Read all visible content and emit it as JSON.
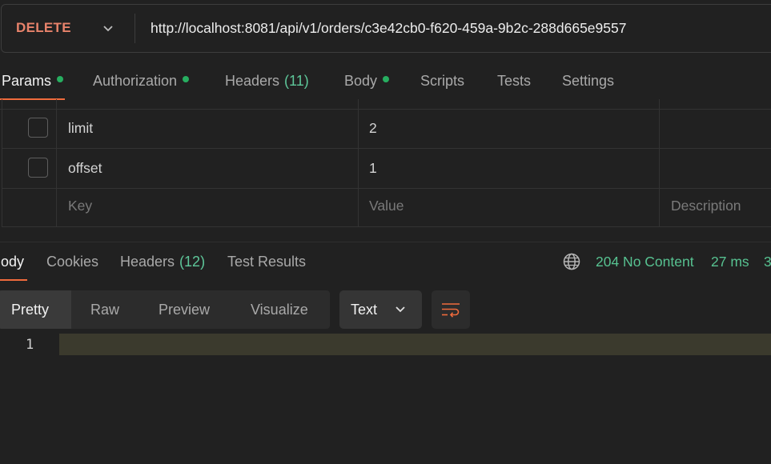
{
  "colors": {
    "method": "#e8836b",
    "accent": "#f06b3c",
    "dot": "#27ae60",
    "count": "#5ec79a",
    "status": "#57c291"
  },
  "request": {
    "method": "DELETE",
    "url": "http://localhost:8081/api/v1/orders/c3e42cb0-f620-459a-9b2c-288d665e9557"
  },
  "request_tabs": [
    {
      "label": "Params",
      "dot": true,
      "active": true
    },
    {
      "label": "Authorization",
      "dot": true
    },
    {
      "label": "Headers",
      "count": "(11)"
    },
    {
      "label": "Body",
      "dot": true
    },
    {
      "label": "Scripts"
    },
    {
      "label": "Tests"
    },
    {
      "label": "Settings"
    }
  ],
  "params": {
    "rows": [
      {
        "key": "limit",
        "value": "2",
        "description": "",
        "checked": false
      },
      {
        "key": "offset",
        "value": "1",
        "description": "",
        "checked": false
      }
    ],
    "placeholders": {
      "key": "Key",
      "value": "Value",
      "description": "Description"
    }
  },
  "response_tabs": [
    {
      "label": "Body",
      "active": true
    },
    {
      "label": "Cookies"
    },
    {
      "label": "Headers",
      "count": "(12)"
    },
    {
      "label": "Test Results"
    }
  ],
  "response_status": {
    "code": "204 No Content",
    "time": "27 ms",
    "size_partial": "3"
  },
  "view_modes": [
    "Pretty",
    "Raw",
    "Preview",
    "Visualize"
  ],
  "active_view_mode": "Pretty",
  "format": "Text",
  "editor": {
    "line_number": "1",
    "content": ""
  }
}
